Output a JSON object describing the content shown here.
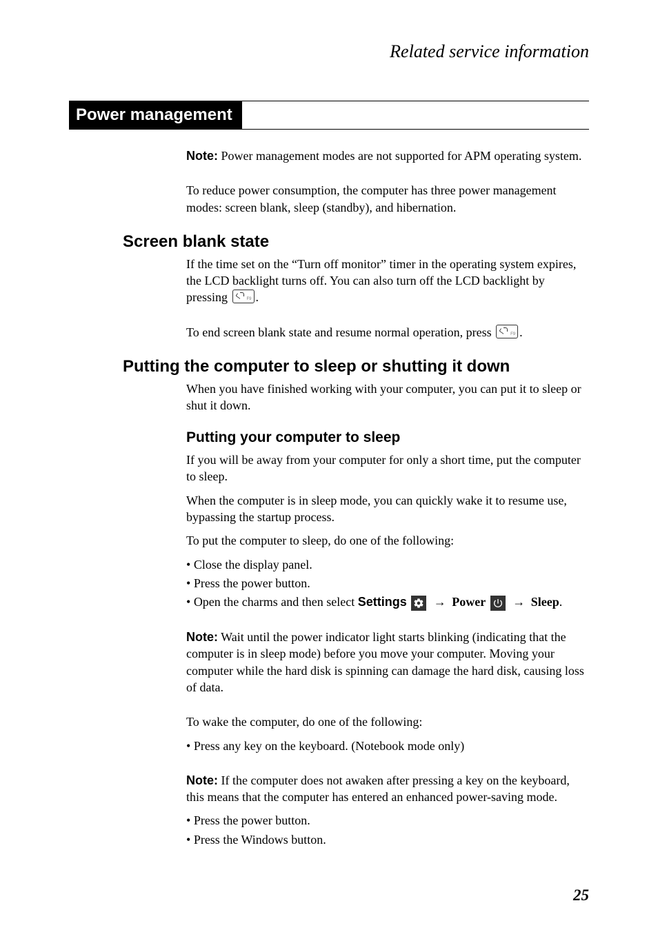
{
  "running_head": "Related service information",
  "section_title": "Power management",
  "note1_label": "Note:",
  "note1_text": " Power management modes are not supported for APM operating system.",
  "intro": "To reduce power consumption, the computer has three power management modes: screen blank, sleep (standby), and hibernation.",
  "h2_screen_blank": "Screen blank state",
  "screen_blank_p1_a": "If the time set on the “Turn off monitor” timer in the operating system expires, the LCD backlight turns off. You can also turn off the LCD backlight by pressing ",
  "screen_blank_p1_b": ".",
  "screen_blank_p2_a": "To end screen blank state and resume normal operation, press ",
  "screen_blank_p2_b": ".",
  "h2_sleep_shut": "Putting the computer to sleep or shutting it down",
  "sleep_shut_intro": "When you have finished working with your computer, you can put it to sleep or shut it down.",
  "h3_put_sleep": "Putting your computer to sleep",
  "put_sleep_p1": "If you will be away from your computer for only a short time, put the computer to sleep.",
  "put_sleep_p2": "When the computer is in sleep mode, you can quickly wake it to resume use, bypassing the startup process.",
  "put_sleep_p3": "To put the computer to sleep, do one of the following:",
  "bullet_close": "Close the display panel.",
  "bullet_power": "Press the power button.",
  "bullet_charms_a": "Open the charms and then select ",
  "label_settings": "Settings",
  "label_power": "Power",
  "label_sleep": "Sleep",
  "note2_label": "Note:",
  "note2_text": " Wait until the power indicator light starts blinking (indicating that the computer is in sleep mode) before you move your computer. Moving your computer while the hard disk is spinning can damage the hard disk, causing loss of data.",
  "wake_p1": "To wake the computer, do one of the following:",
  "bullet_anykey": "Press any key on the keyboard. (Notebook mode only)",
  "note3_label": "Note:",
  "note3_text": " If the computer does not awaken after pressing a key on the keyboard, this means that the computer has entered an enhanced power-saving mode.",
  "bullet_power2": "Press the power button.",
  "bullet_windows": "Press the Windows button.",
  "page_number": "25"
}
